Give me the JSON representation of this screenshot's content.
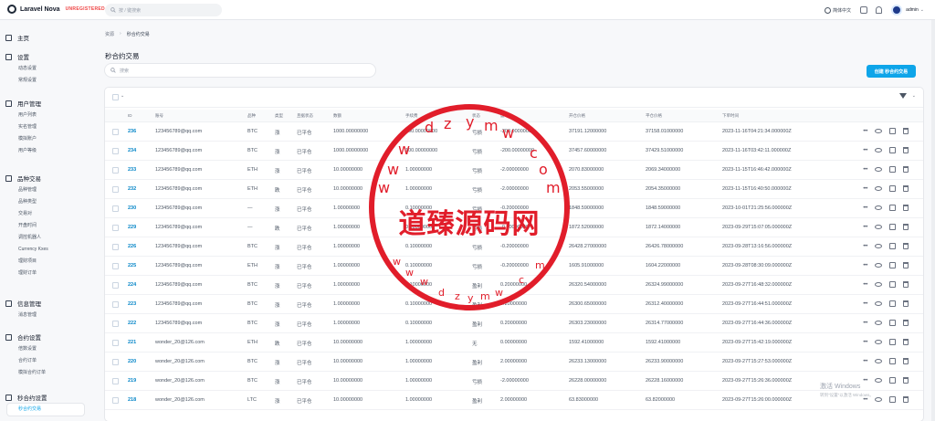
{
  "brand": {
    "name": "Laravel Nova",
    "tag": "UNREGISTERED"
  },
  "global_search": {
    "placeholder": "按 / 键搜索"
  },
  "topbar": {
    "language": "简体中文",
    "user": "admin"
  },
  "sidebar": [
    {
      "label": "主页",
      "icon": "chart-icon",
      "items": []
    },
    {
      "label": "设置",
      "icon": "gear-icon",
      "items": [
        "动态设置",
        "常规设置"
      ]
    },
    {
      "label": "用户管理",
      "icon": "users-icon",
      "items": [
        "用户列表",
        "实名管理",
        "模拟账户",
        "用户等级"
      ]
    },
    {
      "label": "品种交易",
      "icon": "exchange-icon",
      "items": [
        "品种管理",
        "品种类型",
        "交易对",
        "开盘时间",
        "调控机器人",
        "Currency Kxes",
        "理财项目",
        "理财订单"
      ]
    },
    {
      "label": "信息管理",
      "icon": "info-icon",
      "items": [
        "消息管理"
      ]
    },
    {
      "label": "合约设置",
      "icon": "contract-icon",
      "items": [
        "倍数设置",
        "合约订单",
        "模拟合约订单"
      ]
    },
    {
      "label": "秒合约设置",
      "icon": "clock-icon",
      "items": [
        "秒合约交易"
      ]
    }
  ],
  "breadcrumb": {
    "root": "资源",
    "current": "秒合约交易"
  },
  "page": {
    "title": "秒合约交易",
    "search_placeholder": "搜索",
    "create_label": "创建 秒合约交易"
  },
  "table": {
    "columns": [
      "ID",
      "账号",
      "品种",
      "类型",
      "且据状态",
      "数额",
      "手续费",
      "状态",
      "盈亏",
      "开仓价格",
      "平仓价格",
      "下单时间"
    ],
    "rows": [
      [
        "236",
        "123456789@qq.com",
        "BTC",
        "涨",
        "已平仓",
        "1000.00000000",
        "100.00000000",
        "亏损",
        "-200.00000000",
        "37191.12000000",
        "37158.01000000",
        "2023-11-16T04:21:34.000000Z"
      ],
      [
        "234",
        "123456789@qq.com",
        "BTC",
        "涨",
        "已平仓",
        "1000.00000000",
        "100.00000000",
        "亏损",
        "-200.00000000",
        "37457.60000000",
        "37429.51000000",
        "2023-11-16T03:42:11.000000Z"
      ],
      [
        "233",
        "123456789@qq.com",
        "ETH",
        "涨",
        "已平仓",
        "10.00000000",
        "1.00000000",
        "亏损",
        "-2.00000000",
        "2070.83000000",
        "2069.34000000",
        "2023-11-15T16:46:42.000000Z"
      ],
      [
        "232",
        "123456789@qq.com",
        "ETH",
        "跌",
        "已平仓",
        "10.00000000",
        "1.00000000",
        "亏损",
        "-2.00000000",
        "2053.55000000",
        "2054.35000000",
        "2023-11-15T16:40:50.000000Z"
      ],
      [
        "230",
        "123456789@qq.com",
        "—",
        "涨",
        "已平仓",
        "1.00000000",
        "0.10000000",
        "亏损",
        "-0.20000000",
        "1848.59000000",
        "1848.59000000",
        "2023-10-01T21:25:56.000000Z"
      ],
      [
        "229",
        "123456789@qq.com",
        "—",
        "跌",
        "已平仓",
        "1.00000000",
        "0.10000000",
        "亏损",
        "-0.20000000",
        "1872.52000000",
        "1872.14000000",
        "2023-09-29T15:07:05.000000Z"
      ],
      [
        "226",
        "123456789@qq.com",
        "BTC",
        "涨",
        "已平仓",
        "1.00000000",
        "0.10000000",
        "亏损",
        "-0.20000000",
        "26428.27000000",
        "26426.78000000",
        "2023-09-28T13:16:56.000000Z"
      ],
      [
        "225",
        "123456789@qq.com",
        "ETH",
        "涨",
        "已平仓",
        "1.00000000",
        "0.10000000",
        "亏损",
        "-0.20000000",
        "1605.91000000",
        "1604.22000000",
        "2023-09-28T08:30:09.000000Z"
      ],
      [
        "224",
        "123456789@qq.com",
        "BTC",
        "涨",
        "已平仓",
        "1.00000000",
        "0.10000000",
        "盈利",
        "0.20000000",
        "26320.54000000",
        "26324.99000000",
        "2023-09-27T16:48:32.000000Z"
      ],
      [
        "223",
        "123456789@qq.com",
        "BTC",
        "涨",
        "已平仓",
        "1.00000000",
        "0.10000000",
        "盈利",
        "0.20000000",
        "26300.65000000",
        "26312.40000000",
        "2023-09-27T16:44:51.000000Z"
      ],
      [
        "222",
        "123456789@qq.com",
        "BTC",
        "涨",
        "已平仓",
        "1.00000000",
        "0.10000000",
        "盈利",
        "0.20000000",
        "26303.23000000",
        "26314.77000000",
        "2023-09-27T16:44:36.000000Z"
      ],
      [
        "221",
        "wonder_20@126.com",
        "ETH",
        "跌",
        "已平仓",
        "10.00000000",
        "1.00000000",
        "无",
        "0.00000000",
        "1592.41000000",
        "1592.41000000",
        "2023-09-27T15:42:19.000000Z"
      ],
      [
        "220",
        "wonder_20@126.com",
        "BTC",
        "涨",
        "已平仓",
        "10.00000000",
        "1.00000000",
        "盈利",
        "2.00000000",
        "26233.13000000",
        "26233.90000000",
        "2023-09-27T15:27:53.000000Z"
      ],
      [
        "219",
        "wonder_20@126.com",
        "BTC",
        "涨",
        "已平仓",
        "10.00000000",
        "1.00000000",
        "亏损",
        "-2.00000000",
        "26228.00000000",
        "26228.16000000",
        "2023-09-27T15:26:36.000000Z"
      ],
      [
        "218",
        "wonder_20@126.com",
        "LTC",
        "涨",
        "已平仓",
        "10.00000000",
        "1.00000000",
        "盈利",
        "2.00000000",
        "63.83000000",
        "63.82000000",
        "2023-09-27T15:26:00.000000Z"
      ]
    ]
  },
  "watermark": {
    "text": "道臻源码网",
    "windows_line1": "激活 Windows",
    "windows_line2": "转到\"设置\"以激活 Windows。"
  },
  "colors": {
    "accent": "#0ea5e9",
    "stamp": "#e11d2a",
    "link": "#0284c7"
  }
}
